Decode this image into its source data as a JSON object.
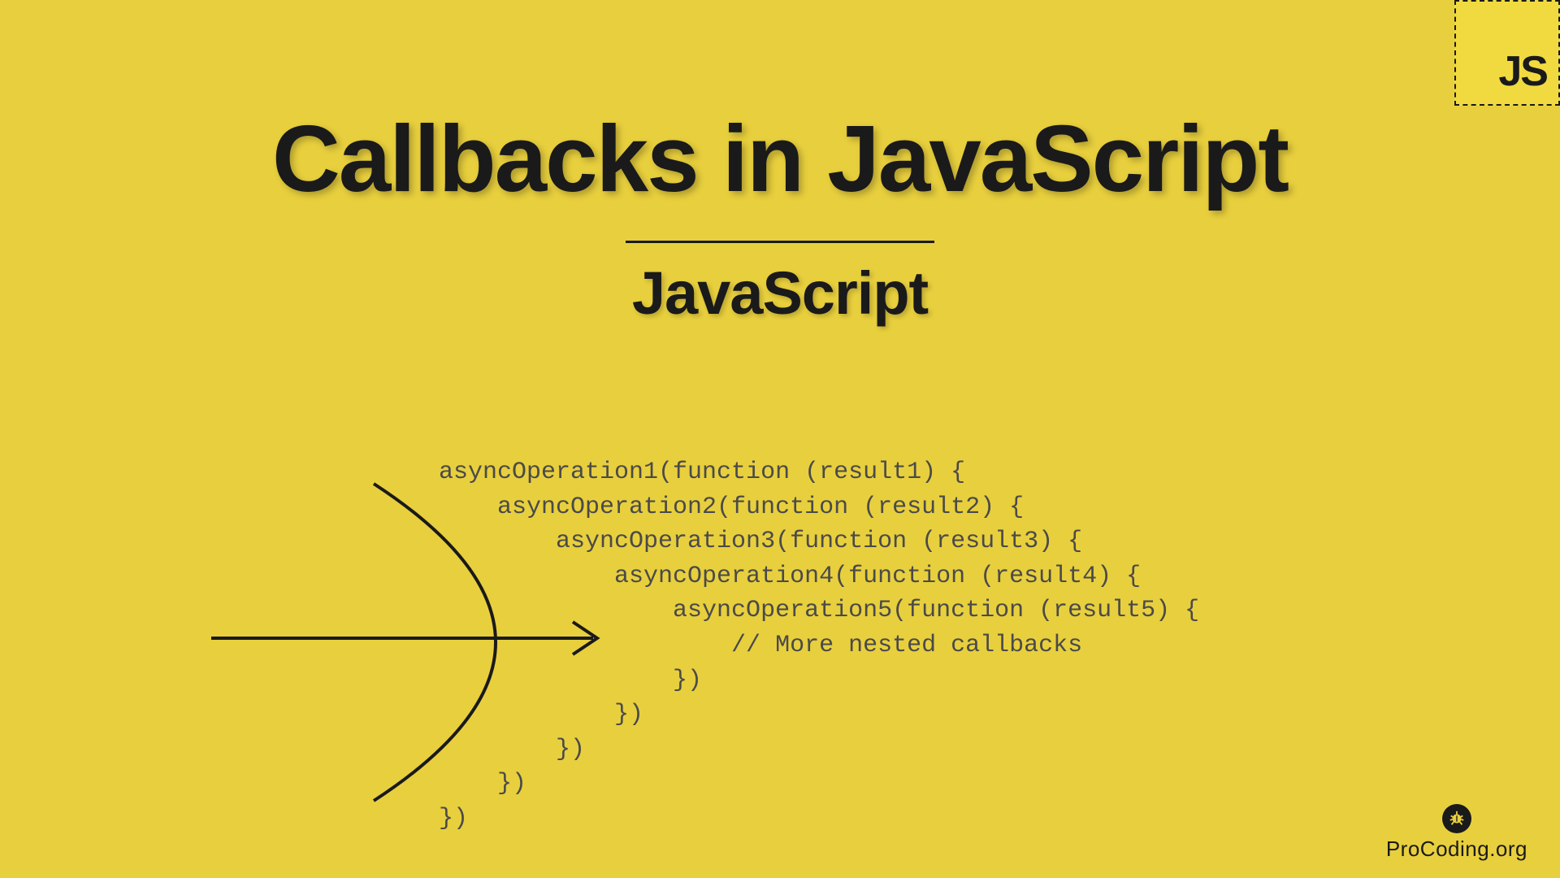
{
  "badge": {
    "text": "JS"
  },
  "title": "Callbacks in JavaScript",
  "subtitle": "JavaScript",
  "code": {
    "line1": "asyncOperation1(function (result1) {",
    "line2": "    asyncOperation2(function (result2) {",
    "line3": "        asyncOperation3(function (result3) {",
    "line4": "            asyncOperation4(function (result4) {",
    "line5": "                asyncOperation5(function (result5) {",
    "line6": "                    // More nested callbacks",
    "line7": "                })",
    "line8": "            })",
    "line9": "        })",
    "line10": "    })",
    "line11": "})"
  },
  "brand": {
    "text": "ProCoding.org"
  }
}
